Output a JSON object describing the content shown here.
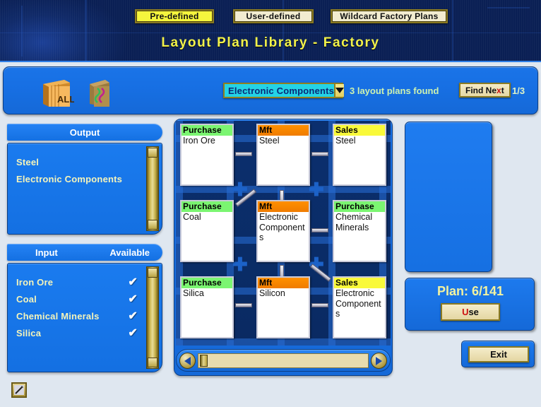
{
  "header": {
    "title": "Layout Plan Library - Factory",
    "tabs": [
      {
        "label": "Pre-defined",
        "active": true
      },
      {
        "label": "User-defined",
        "active": false
      },
      {
        "label": "Wildcard Factory Plans",
        "active": false
      }
    ]
  },
  "toolbar": {
    "all_books_icon_label": "ALL",
    "filter_value": "Electronic Components",
    "found_text": "3 layout plans found",
    "find_next_label": "Find Next",
    "find_next_accel": "x",
    "find_position": "1/3"
  },
  "output_panel": {
    "title": "Output",
    "items": [
      "Steel",
      "Electronic Components"
    ]
  },
  "input_panel": {
    "title": "Input",
    "available_title": "Available",
    "items": [
      {
        "name": "Iron Ore",
        "available": true
      },
      {
        "name": "Coal",
        "available": true
      },
      {
        "name": "Chemical Minerals",
        "available": true
      },
      {
        "name": "Silica",
        "available": true
      }
    ],
    "check_glyph": "✔"
  },
  "grid": {
    "cards": [
      {
        "type": "Purchase",
        "kind": "purchase",
        "name": "Iron Ore",
        "col": 0,
        "row": 0
      },
      {
        "type": "Mft",
        "kind": "mft",
        "name": "Steel",
        "col": 1,
        "row": 0
      },
      {
        "type": "Sales",
        "kind": "sales",
        "name": "Steel",
        "col": 2,
        "row": 0
      },
      {
        "type": "Purchase",
        "kind": "purchase",
        "name": "Coal",
        "col": 0,
        "row": 1
      },
      {
        "type": "Mft",
        "kind": "mft",
        "name": "Electronic Components",
        "col": 1,
        "row": 1
      },
      {
        "type": "Purchase",
        "kind": "purchase",
        "name": "Chemical Minerals",
        "col": 2,
        "row": 1
      },
      {
        "type": "Purchase",
        "kind": "purchase",
        "name": "Silica",
        "col": 0,
        "row": 2
      },
      {
        "type": "Mft",
        "kind": "mft",
        "name": "Silicon",
        "col": 1,
        "row": 2
      },
      {
        "type": "Sales",
        "kind": "sales",
        "name": "Electronic Components",
        "col": 2,
        "row": 2
      }
    ]
  },
  "right_panel": {
    "plan_label": "Plan: 6/141",
    "use_label": "Use",
    "use_accel": "U",
    "exit_label": "Exit"
  },
  "colors": {
    "accent_blue": "#1a74e8",
    "dark_blue": "#0a2a62",
    "gold": "#e4d6a2",
    "purchase_green": "#7bf571",
    "mft_orange": "#ff9000",
    "sales_yellow": "#f9f93a",
    "title_yellow": "#f2f24a"
  }
}
